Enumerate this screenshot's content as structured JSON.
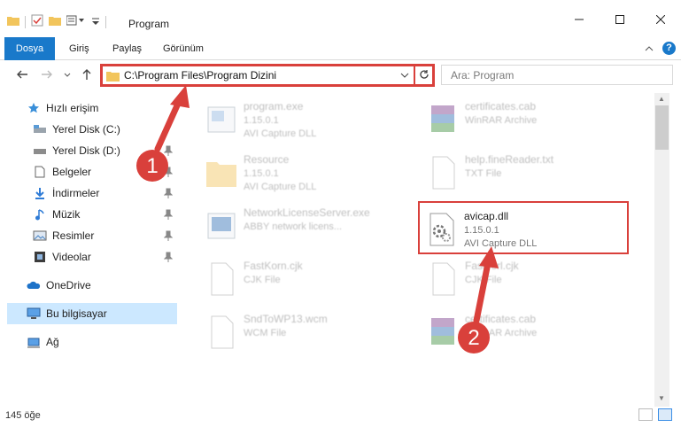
{
  "window": {
    "title": "Program",
    "min_icon": "minimize-icon",
    "max_icon": "maximize-icon",
    "close_icon": "close-icon"
  },
  "ribbon": {
    "tabs": [
      "Dosya",
      "Giriş",
      "Paylaş",
      "Görünüm"
    ],
    "accent": "#1979ca",
    "help": "?"
  },
  "nav": {
    "address": "C:\\Program Files\\Program Dizini",
    "search_placeholder": "Ara: Program"
  },
  "sidebar": {
    "items": [
      {
        "label": "Hızlı erişim",
        "icon": "star-icon"
      },
      {
        "label": "Yerel Disk (C:)",
        "icon": "drive-icon",
        "pinned": true
      },
      {
        "label": "Yerel Disk (D:)",
        "icon": "drive-icon",
        "pinned": true
      },
      {
        "label": "Belgeler",
        "icon": "documents-icon",
        "pinned": true
      },
      {
        "label": "İndirmeler",
        "icon": "downloads-icon",
        "pinned": true
      },
      {
        "label": "Müzik",
        "icon": "music-icon",
        "pinned": true
      },
      {
        "label": "Resimler",
        "icon": "pictures-icon",
        "pinned": true
      },
      {
        "label": "Videolar",
        "icon": "videos-icon",
        "pinned": true
      },
      {
        "label": "OneDrive",
        "icon": "cloud-icon"
      },
      {
        "label": "Bu bilgisayar",
        "icon": "computer-icon",
        "selected": true
      },
      {
        "label": "Ağ",
        "icon": "network-icon"
      }
    ]
  },
  "files": [
    {
      "name": "program.exe",
      "line2": "1.15.0.1",
      "line3": "AVI Capture DLL",
      "icon": "exe-icon"
    },
    {
      "name": "certificates.cab",
      "line2": "WinRAR Archive",
      "line3": "",
      "icon": "winrar-icon"
    },
    {
      "name": "Resource",
      "line2": "1.15.0.1",
      "line3": "AVI Capture DLL",
      "icon": "folder-icon"
    },
    {
      "name": "help.fineReader.txt",
      "line2": "TXT File",
      "line3": "",
      "icon": "file-icon"
    },
    {
      "name": "NetworkLicenseServer.exe",
      "line2": "ABBY network licens...",
      "line3": "",
      "icon": "exe-icon"
    },
    {
      "name": "avicap.dll",
      "line2": "1.15.0.1",
      "line3": "AVI Capture DLL",
      "icon": "dll-gear-icon"
    },
    {
      "name": "FastKorn.cjk",
      "line2": "CJK File",
      "line3": "",
      "icon": "file-icon"
    },
    {
      "name": "Fastverl.cjk",
      "line2": "CJK File",
      "line3": "",
      "icon": "file-icon"
    },
    {
      "name": "SndToWP13.wcm",
      "line2": "WCM File",
      "line3": "",
      "icon": "file-icon"
    },
    {
      "name": "certificates.cab",
      "line2": "WinRAR Archive",
      "line3": "",
      "icon": "winrar-icon"
    }
  ],
  "status": {
    "count": "145 öğe"
  },
  "annotations": {
    "color": "#d9403b",
    "step1": "1",
    "step2": "2"
  }
}
